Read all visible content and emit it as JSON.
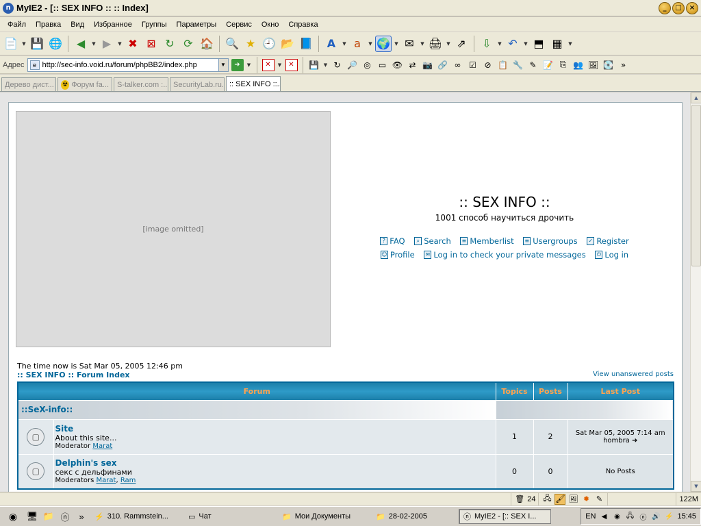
{
  "window": {
    "title": "MyIE2 - [:: SEX INFO :: :: Index]",
    "app_icon": "n",
    "controls": [
      "_",
      "□",
      "×"
    ]
  },
  "menu": [
    "Файл",
    "Правка",
    "Вид",
    "Избранное",
    "Группы",
    "Параметры",
    "Сервис",
    "Окно",
    "Справка"
  ],
  "toolbar": {
    "icons": [
      "new-page-icon",
      "save-icon",
      "globe-icon",
      "back-icon",
      "forward-icon",
      "stop-icon",
      "stop-all-icon",
      "refresh-icon",
      "refresh-all-icon",
      "home-icon",
      "search-icon",
      "favorites-star-icon",
      "history-icon",
      "folder-icon",
      "book-icon",
      "font-icon",
      "encoding-icon",
      "online-icon",
      "mail-icon",
      "print-icon",
      "proxy-icon",
      "download-icon",
      "undo-icon",
      "fullscreen-icon",
      "grid-icon"
    ]
  },
  "address": {
    "label": "Адрес",
    "url": "http://sec-info.void.ru/forum/phpBB2/index.php"
  },
  "tabs": [
    {
      "label": "Дерево дист...",
      "active": false
    },
    {
      "label": "Форум fa...",
      "active": false
    },
    {
      "label": "S-talker.com :...",
      "active": false
    },
    {
      "label": "SecurityLab.ru...",
      "active": false
    },
    {
      "label": ":: SEX INFO ::...",
      "active": true
    }
  ],
  "page": {
    "site_title": ":: SEX INFO ::",
    "site_desc": "1001 способ научиться дрочить",
    "nav_row1": [
      "FAQ",
      "Search",
      "Memberlist",
      "Usergroups",
      "Register"
    ],
    "nav_row2": [
      "Profile",
      "Log in to check your private messages",
      "Log in"
    ],
    "time_now": "The time now is Sat Mar 05, 2005 12:46 pm",
    "breadcrumb": ":: SEX INFO :: Forum Index",
    "unanswered": "View unanswered posts",
    "table_headers": [
      "Forum",
      "Topics",
      "Posts",
      "Last Post"
    ],
    "category": "::SeX-info::",
    "forums": [
      {
        "name": "Site",
        "desc": "About this site...",
        "mod_label": "Moderator",
        "mods": [
          "Marat"
        ],
        "topics": "1",
        "posts": "2",
        "last_post": "Sat Mar 05, 2005 7:14 am",
        "last_user": "hombra"
      },
      {
        "name": "Delphin's sex",
        "desc": "секс с дельфинами",
        "mod_label": "Moderators",
        "mods": [
          "Marat",
          "Ram"
        ],
        "topics": "0",
        "posts": "0",
        "last_post": "No Posts",
        "last_user": ""
      }
    ]
  },
  "statusbar": {
    "trash_count": "24",
    "memory": "122M"
  },
  "taskbar": {
    "tasks": [
      {
        "label": "310. Rammstein...",
        "icon": "winamp-icon",
        "active": false
      },
      {
        "label": "Чат",
        "icon": "chat-icon",
        "active": false
      },
      {
        "label": "Мои Документы",
        "icon": "folder-icon",
        "active": false
      },
      {
        "label": "28-02-2005",
        "icon": "folder-icon",
        "active": false
      },
      {
        "label": "MyIE2 - [:: SEX I...",
        "icon": "myie-icon",
        "active": true
      }
    ],
    "lang": "EN",
    "clock": "15:45"
  }
}
